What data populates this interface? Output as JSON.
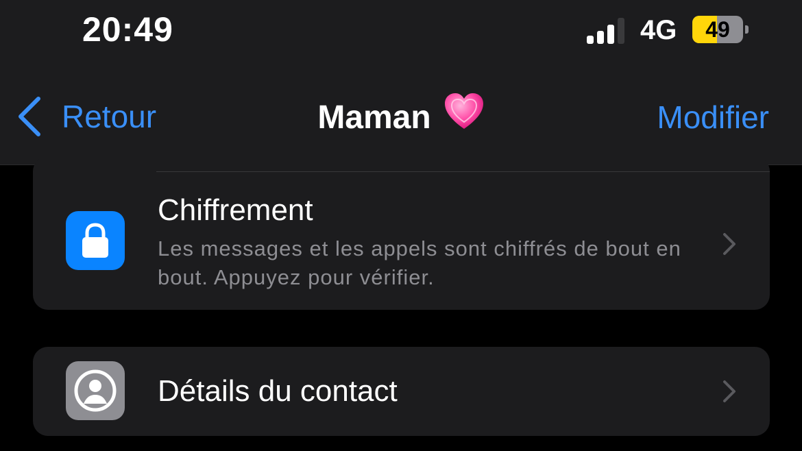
{
  "status_bar": {
    "time": "20:49",
    "network": "4G",
    "battery_level": "49",
    "battery_fraction": 0.49,
    "signal_bars_active": 3,
    "signal_bars_total": 4
  },
  "nav": {
    "back_label": "Retour",
    "title": "Maman",
    "title_emoji_icon": "growing-heart-icon",
    "edit_label": "Modifier"
  },
  "encryption": {
    "title": "Chiffrement",
    "subtitle": "Les messages et les appels sont chiffrés de bout en bout. Appuyez pour vérifier.",
    "icon": "lock-icon"
  },
  "contact_details": {
    "title": "Détails du contact",
    "icon": "person-circle-icon"
  },
  "colors": {
    "accent": "#3a8ff7",
    "lock_bg": "#0a84ff",
    "battery_fill": "#ffd60a",
    "card_bg": "#1c1c1e",
    "secondary_text": "#8e8e93"
  }
}
